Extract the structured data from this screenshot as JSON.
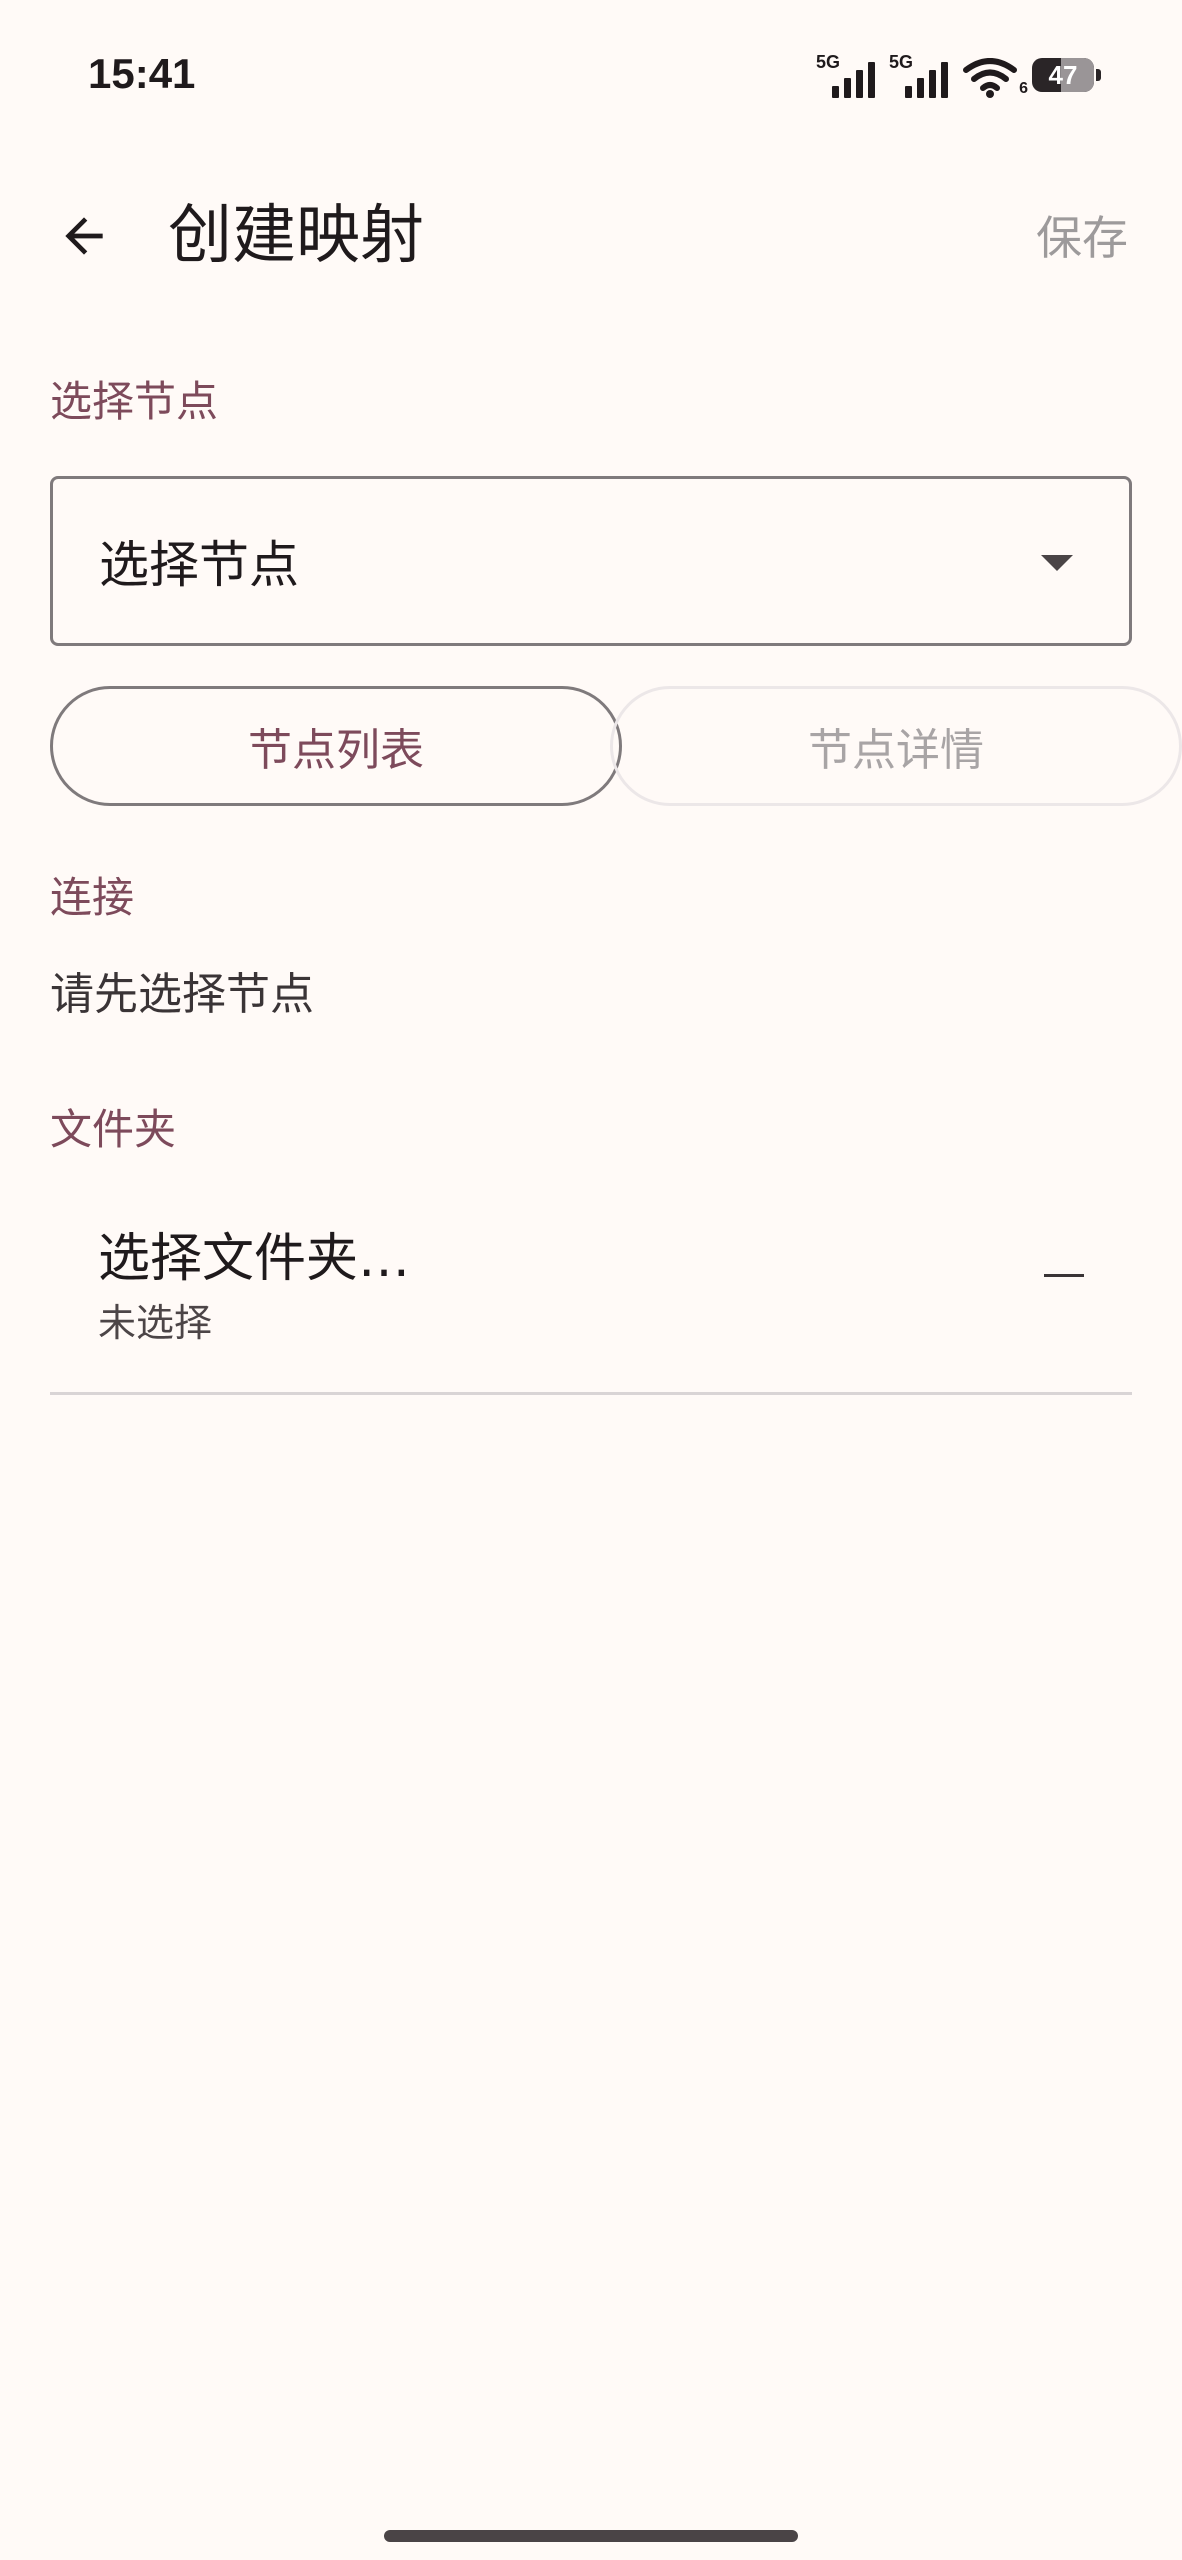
{
  "status_bar": {
    "time": "15:41",
    "sim1_label": "5G",
    "sim2_label": "5G",
    "wifi_badge": "6",
    "battery_level": "47",
    "icons": [
      "signal-icon",
      "signal-icon",
      "wifi-icon",
      "battery-icon"
    ]
  },
  "app_bar": {
    "back_icon": "arrow-back-icon",
    "title": "创建映射",
    "save_label": "保存"
  },
  "node_section": {
    "label": "选择节点",
    "dropdown_value": "选择节点",
    "dropdown_icon": "arrow-drop-down-icon",
    "node_list_button": "节点列表",
    "node_details_button": "节点详情"
  },
  "connection_section": {
    "label": "连接",
    "message": "请先选择节点"
  },
  "folder_section": {
    "label": "文件夹",
    "title": "选择文件夹…",
    "subtitle": "未选择",
    "trailing_icon": "dash-icon"
  },
  "colors": {
    "background": "#fffaf7",
    "accent": "#7d4a5b",
    "disabled_text": "#a8a4a5",
    "outline": "#7f7a7c"
  }
}
